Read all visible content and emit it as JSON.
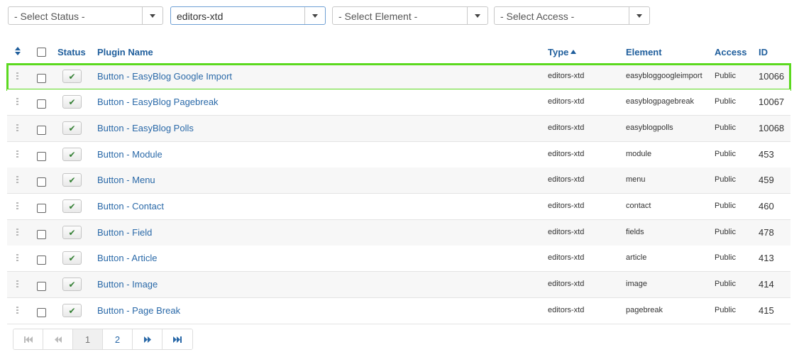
{
  "filters": {
    "status": "- Select Status -",
    "folder": "editors-xtd",
    "element": "- Select Element -",
    "access": "- Select Access -"
  },
  "table": {
    "headers": {
      "status": "Status",
      "name": "Plugin Name",
      "type": "Type",
      "element": "Element",
      "access": "Access",
      "id": "ID"
    },
    "rows": [
      {
        "name": "Button - EasyBlog Google Import",
        "type": "editors-xtd",
        "element": "easybloggoogleimport",
        "access": "Public",
        "id": "10066"
      },
      {
        "name": "Button - EasyBlog Pagebreak",
        "type": "editors-xtd",
        "element": "easyblogpagebreak",
        "access": "Public",
        "id": "10067"
      },
      {
        "name": "Button - EasyBlog Polls",
        "type": "editors-xtd",
        "element": "easyblogpolls",
        "access": "Public",
        "id": "10068"
      },
      {
        "name": "Button - Module",
        "type": "editors-xtd",
        "element": "module",
        "access": "Public",
        "id": "453"
      },
      {
        "name": "Button - Menu",
        "type": "editors-xtd",
        "element": "menu",
        "access": "Public",
        "id": "459"
      },
      {
        "name": "Button - Contact",
        "type": "editors-xtd",
        "element": "contact",
        "access": "Public",
        "id": "460"
      },
      {
        "name": "Button - Field",
        "type": "editors-xtd",
        "element": "fields",
        "access": "Public",
        "id": "478"
      },
      {
        "name": "Button - Article",
        "type": "editors-xtd",
        "element": "article",
        "access": "Public",
        "id": "413"
      },
      {
        "name": "Button - Image",
        "type": "editors-xtd",
        "element": "image",
        "access": "Public",
        "id": "414"
      },
      {
        "name": "Button - Page Break",
        "type": "editors-xtd",
        "element": "pagebreak",
        "access": "Public",
        "id": "415"
      }
    ]
  },
  "pagination": {
    "pages": [
      "1",
      "2"
    ]
  },
  "colors": {
    "link": "#2a69a8",
    "header": "#1f5e9c",
    "highlight": "#5bd91f",
    "check": "#378137"
  }
}
